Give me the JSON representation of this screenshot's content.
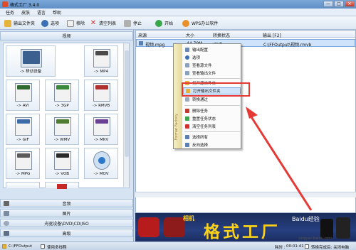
{
  "window": {
    "title": "格式工厂 3.4.0",
    "buttons": [
      "—",
      "□",
      "✕"
    ]
  },
  "menubar": [
    "任务",
    "皮肤",
    "语言",
    "帮助"
  ],
  "toolbar": {
    "output_folder": "输出文件夹",
    "options": "选项",
    "remove": "移除",
    "clear_list": "清空列表",
    "stop": "停止",
    "start": "开始",
    "wps": "WPS办公软件"
  },
  "sidebar": {
    "category_video": "视频",
    "tiles": [
      {
        "label": "-> 移动设备",
        "icon": "mobile-device-icon"
      },
      {
        "label": "-> MP4",
        "icon": "mp4-file-icon"
      },
      {
        "label": "-> AVI",
        "icon": "avi-file-icon"
      },
      {
        "label": "-> 3GP",
        "icon": "3gp-file-icon"
      },
      {
        "label": "-> RMVB",
        "icon": "rmvb-file-icon"
      },
      {
        "label": "-> GIF",
        "icon": "gif-file-icon"
      },
      {
        "label": "-> WMV",
        "icon": "wmv-file-icon"
      },
      {
        "label": "-> MKV",
        "icon": "mkv-file-icon"
      },
      {
        "label": "-> MPG",
        "icon": "mpg-file-icon"
      },
      {
        "label": "-> VOB",
        "icon": "vob-file-icon"
      },
      {
        "label": "-> MOV",
        "icon": "mov-file-icon"
      }
    ],
    "categories": [
      "音频",
      "图片",
      "光驱设备\\DVD\\CD\\ISO",
      "高级"
    ]
  },
  "table": {
    "headers": [
      "来源",
      "大小",
      "转换状态",
      "输出 [F2]"
    ],
    "rows": [
      {
        "source": "视频.mpg",
        "size": "44.79M",
        "status": "完成",
        "output": "C:\\FFOutput\\视频.rmvb"
      }
    ]
  },
  "context_menu": {
    "side_text": "Format Factory",
    "items": [
      "输出配置",
      "选项",
      "查看源文件",
      "查看输出文件",
      "打开源文件夹",
      "打开输出文件夹",
      "转换通过",
      "删除任务",
      "重置任务状态",
      "清空任务列表",
      "选择所有",
      "反向选择"
    ],
    "selected_index": 5
  },
  "banner": {
    "small_text": "相机",
    "big_text": "格式工厂",
    "watermark": "Baidu经验"
  },
  "statusbar": {
    "output_path": "C:\\FFOutput",
    "multithread": "使用多线程",
    "elapsed_label": "耗时 :",
    "elapsed": "00:01:41",
    "after_convert": "转换完成后: 关闭电脑",
    "watermark": "jingyan.baidu.com"
  },
  "colors": {
    "accent_red": "#e53935",
    "banner_text": "#ffd21a",
    "selection": "#cfe3fb"
  }
}
